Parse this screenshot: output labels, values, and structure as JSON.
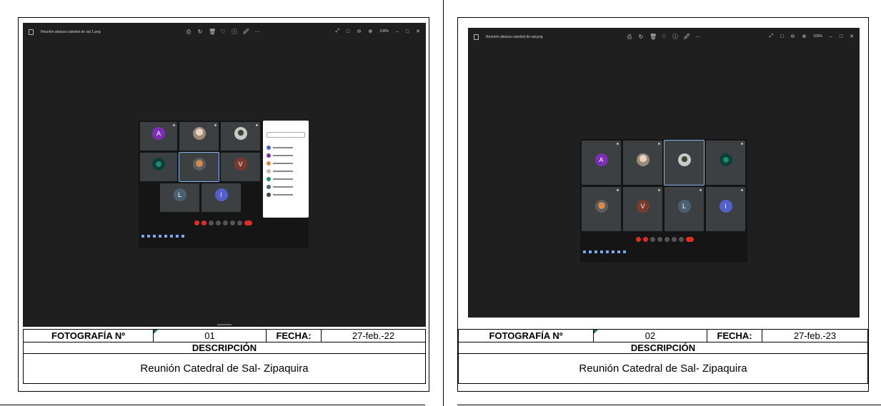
{
  "photos": [
    {
      "viewer": {
        "filename": "Reunión alianza catedral de sal 1.png",
        "zoom": "100%",
        "tool_icons": [
          "⎙",
          "↻",
          "🗑",
          "♡",
          "ⓘ",
          "🖉",
          "···"
        ],
        "window_controls": [
          "⤢",
          "□",
          "⊖",
          "⊕",
          "–",
          "□",
          "✕"
        ]
      },
      "participants": [
        {
          "initial": "A"
        },
        {
          "initial": ""
        },
        {
          "initial": ""
        },
        {
          "initial": ""
        },
        {
          "initial": ""
        },
        {
          "initial": "V"
        },
        {
          "initial": "L"
        },
        {
          "initial": "I"
        }
      ],
      "label_photo": "FOTOGRAFÍA Nº",
      "number": "01",
      "label_date": "FECHA:",
      "date": "27-feb.-22",
      "label_description": "DESCRIPCIÓN",
      "description": "Reunión Catedral de Sal- Zipaquira"
    },
    {
      "viewer": {
        "filename": "Reunión alianza catedral de sal.png",
        "zoom": "100%",
        "tool_icons": [
          "⎙",
          "↻",
          "🗑",
          "♡",
          "ⓘ",
          "🖉",
          "···"
        ],
        "window_controls": [
          "⤢",
          "□",
          "⊖",
          "⊕",
          "–",
          "□",
          "✕"
        ]
      },
      "participants": [
        {
          "initial": "A"
        },
        {
          "initial": ""
        },
        {
          "initial": ""
        },
        {
          "initial": ""
        },
        {
          "initial": ""
        },
        {
          "initial": "V"
        },
        {
          "initial": "L"
        },
        {
          "initial": "I"
        }
      ],
      "label_photo": "FOTOGRAFÍA Nº",
      "number": "02",
      "label_date": "FECHA:",
      "date": "27-feb.-23",
      "label_description": "DESCRIPCIÓN",
      "description": "Reunión Catedral de Sal- Zipaquira"
    }
  ]
}
